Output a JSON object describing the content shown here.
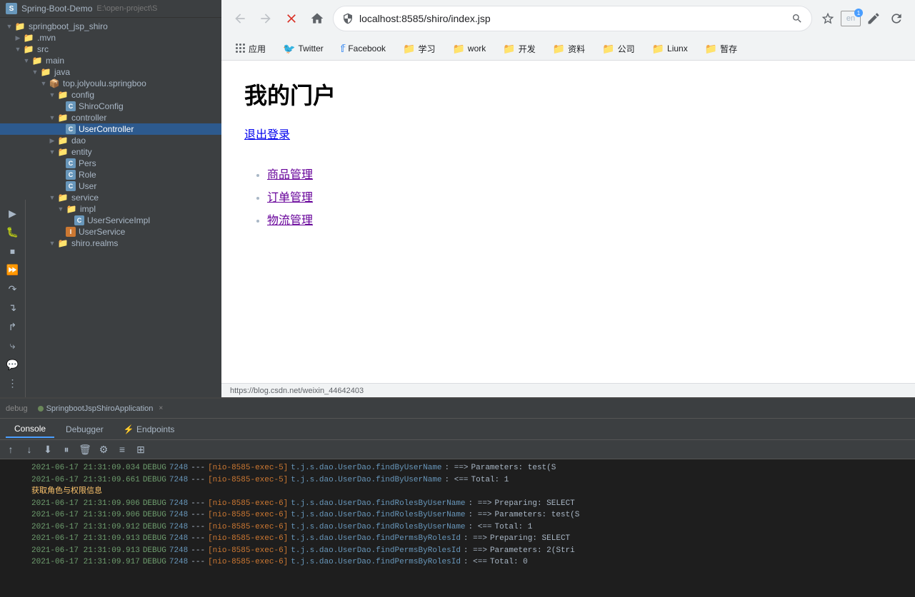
{
  "ide": {
    "title": "Spring-Boot-Demo",
    "project_path": "E:\\open-project\\S",
    "root_folder": "springboot_jsp_shiro",
    "tree": [
      {
        "id": "mvn",
        "label": ".mvn",
        "type": "folder",
        "indent": 2,
        "chevron": "▶",
        "expanded": false
      },
      {
        "id": "src",
        "label": "src",
        "type": "folder",
        "indent": 2,
        "chevron": "▼",
        "expanded": true
      },
      {
        "id": "main",
        "label": "main",
        "type": "folder",
        "indent": 3,
        "chevron": "▼",
        "expanded": true
      },
      {
        "id": "java",
        "label": "java",
        "type": "folder",
        "indent": 4,
        "chevron": "▼",
        "expanded": true
      },
      {
        "id": "package",
        "label": "top.jolyoulu.springboo",
        "type": "package",
        "indent": 5,
        "chevron": "▼",
        "expanded": true
      },
      {
        "id": "config",
        "label": "config",
        "type": "folder",
        "indent": 6,
        "chevron": "▼",
        "expanded": true
      },
      {
        "id": "ShiroConfig",
        "label": "ShiroConfig",
        "type": "class",
        "indent": 7
      },
      {
        "id": "controller",
        "label": "controller",
        "type": "folder",
        "indent": 6,
        "chevron": "▼",
        "expanded": true
      },
      {
        "id": "UserController",
        "label": "UserController",
        "type": "class",
        "indent": 7
      },
      {
        "id": "dao",
        "label": "dao",
        "type": "folder",
        "indent": 6,
        "chevron": "▶",
        "expanded": false
      },
      {
        "id": "entity",
        "label": "entity",
        "type": "folder",
        "indent": 6,
        "chevron": "▼",
        "expanded": true
      },
      {
        "id": "Pers",
        "label": "Pers",
        "type": "class",
        "indent": 7
      },
      {
        "id": "Role",
        "label": "Role",
        "type": "class",
        "indent": 7
      },
      {
        "id": "User",
        "label": "User",
        "type": "class",
        "indent": 7
      },
      {
        "id": "service",
        "label": "service",
        "type": "folder",
        "indent": 6,
        "chevron": "▼",
        "expanded": true
      },
      {
        "id": "impl",
        "label": "impl",
        "type": "folder",
        "indent": 7,
        "chevron": "▼",
        "expanded": true
      },
      {
        "id": "UserServiceImpl",
        "label": "UserServiceImpl",
        "type": "class",
        "indent": 8
      },
      {
        "id": "UserService",
        "label": "UserService",
        "type": "interface",
        "indent": 7
      },
      {
        "id": "shiro_realms",
        "label": "shiro.realms",
        "type": "folder",
        "indent": 6,
        "chevron": "▼",
        "expanded": true
      }
    ]
  },
  "run_tab": {
    "label": "debug",
    "app_name": "SpringbootJspShiroApplication",
    "close": "×"
  },
  "bottom_tabs": [
    {
      "id": "console",
      "label": "Console",
      "active": true
    },
    {
      "id": "debugger",
      "label": "Debugger",
      "active": false
    },
    {
      "id": "endpoints",
      "label": "Endpoints",
      "active": false
    }
  ],
  "console_lines": [
    {
      "ts": "2021-06-17 21:31:09.034",
      "level": "DEBUG",
      "thread": "7248",
      "sep": "---",
      "exec": "[nio-8585-exec-5]",
      "class": "t.j.s.dao.UserDao.findByUserName",
      "arrow": ":  ==>",
      "msg": "Parameters: test(S"
    },
    {
      "ts": "2021-06-17 21:31:09.661",
      "level": "DEBUG",
      "thread": "7248",
      "sep": "---",
      "exec": "[nio-8585-exec-5]",
      "class": "t.j.s.dao.UserDao.findByUserName",
      "arrow": ":  <==",
      "msg": "Total: 1"
    },
    {
      "ts": "",
      "level": "",
      "thread": "",
      "sep": "",
      "exec": "",
      "class": "获取角色与权限信息",
      "arrow": "",
      "msg": ""
    },
    {
      "ts": "2021-06-17 21:31:09.906",
      "level": "DEBUG",
      "thread": "7248",
      "sep": "---",
      "exec": "[nio-8585-exec-6]",
      "class": "t.j.s.dao.UserDao.findRolesByUserName",
      "arrow": ":  ==>",
      "msg": "Preparing: SELECT"
    },
    {
      "ts": "2021-06-17 21:31:09.906",
      "level": "DEBUG",
      "thread": "7248",
      "sep": "---",
      "exec": "[nio-8585-exec-6]",
      "class": "t.j.s.dao.UserDao.findRolesByUserName",
      "arrow": ":  ==>",
      "msg": "Parameters: test(S"
    },
    {
      "ts": "2021-06-17 21:31:09.912",
      "level": "DEBUG",
      "thread": "7248",
      "sep": "---",
      "exec": "[nio-8585-exec-6]",
      "class": "t.j.s.dao.UserDao.findRolesByUserName",
      "arrow": ":  <==",
      "msg": "Total: 1"
    },
    {
      "ts": "2021-06-17 21:31:09.913",
      "level": "DEBUG",
      "thread": "7248",
      "sep": "---",
      "exec": "[nio-8585-exec-6]",
      "class": "t.j.s.dao.UserDao.findPermsByRolesId",
      "arrow": ":  ==>",
      "msg": "Preparing: SELECT"
    },
    {
      "ts": "2021-06-17 21:31:09.913",
      "level": "DEBUG",
      "thread": "7248",
      "sep": "---",
      "exec": "[nio-8585-exec-6]",
      "class": "t.j.s.dao.UserDao.findPermsByRolesId",
      "arrow": ":  ==>",
      "msg": "Parameters: 2(Stri"
    },
    {
      "ts": "2021-06-17 21:31:09.917",
      "level": "DEBUG",
      "thread": "7248",
      "sep": "---",
      "exec": "[nio-8585-exec-6]",
      "class": "t.j.s.dao.UserDao.findPermsByRolesId",
      "arrow": ":  <==",
      "msg": "Total: 0"
    }
  ],
  "browser": {
    "url": "localhost:8585/shiro/index.jsp",
    "nav": {
      "back_disabled": true,
      "forward_disabled": true
    },
    "bookmarks": [
      {
        "id": "apps",
        "label": "应用",
        "icon": "apps"
      },
      {
        "id": "twitter",
        "label": "Twitter",
        "icon": "twitter"
      },
      {
        "id": "facebook",
        "label": "Facebook",
        "icon": "facebook"
      },
      {
        "id": "study",
        "label": "学习",
        "icon": "folder"
      },
      {
        "id": "work",
        "label": "work",
        "icon": "folder"
      },
      {
        "id": "kaifa",
        "label": "开发",
        "icon": "folder"
      },
      {
        "id": "data",
        "label": "资料",
        "icon": "folder"
      },
      {
        "id": "company",
        "label": "公司",
        "icon": "folder"
      },
      {
        "id": "liunx",
        "label": "Liunx",
        "icon": "folder"
      },
      {
        "id": "zanshi",
        "label": "暂存",
        "icon": "folder"
      }
    ],
    "page": {
      "title": "我的门户",
      "logout_text": "退出登录",
      "menu_items": [
        {
          "id": "goods",
          "label": "商品管理",
          "href": "#"
        },
        {
          "id": "orders",
          "label": "订单管理",
          "href": "#"
        },
        {
          "id": "logistics",
          "label": "物流管理",
          "href": "#"
        }
      ]
    },
    "status_bar_url": "https://blog.csdn.net/weixin_44642403"
  },
  "extension": {
    "lang": "en",
    "badge": "1"
  }
}
